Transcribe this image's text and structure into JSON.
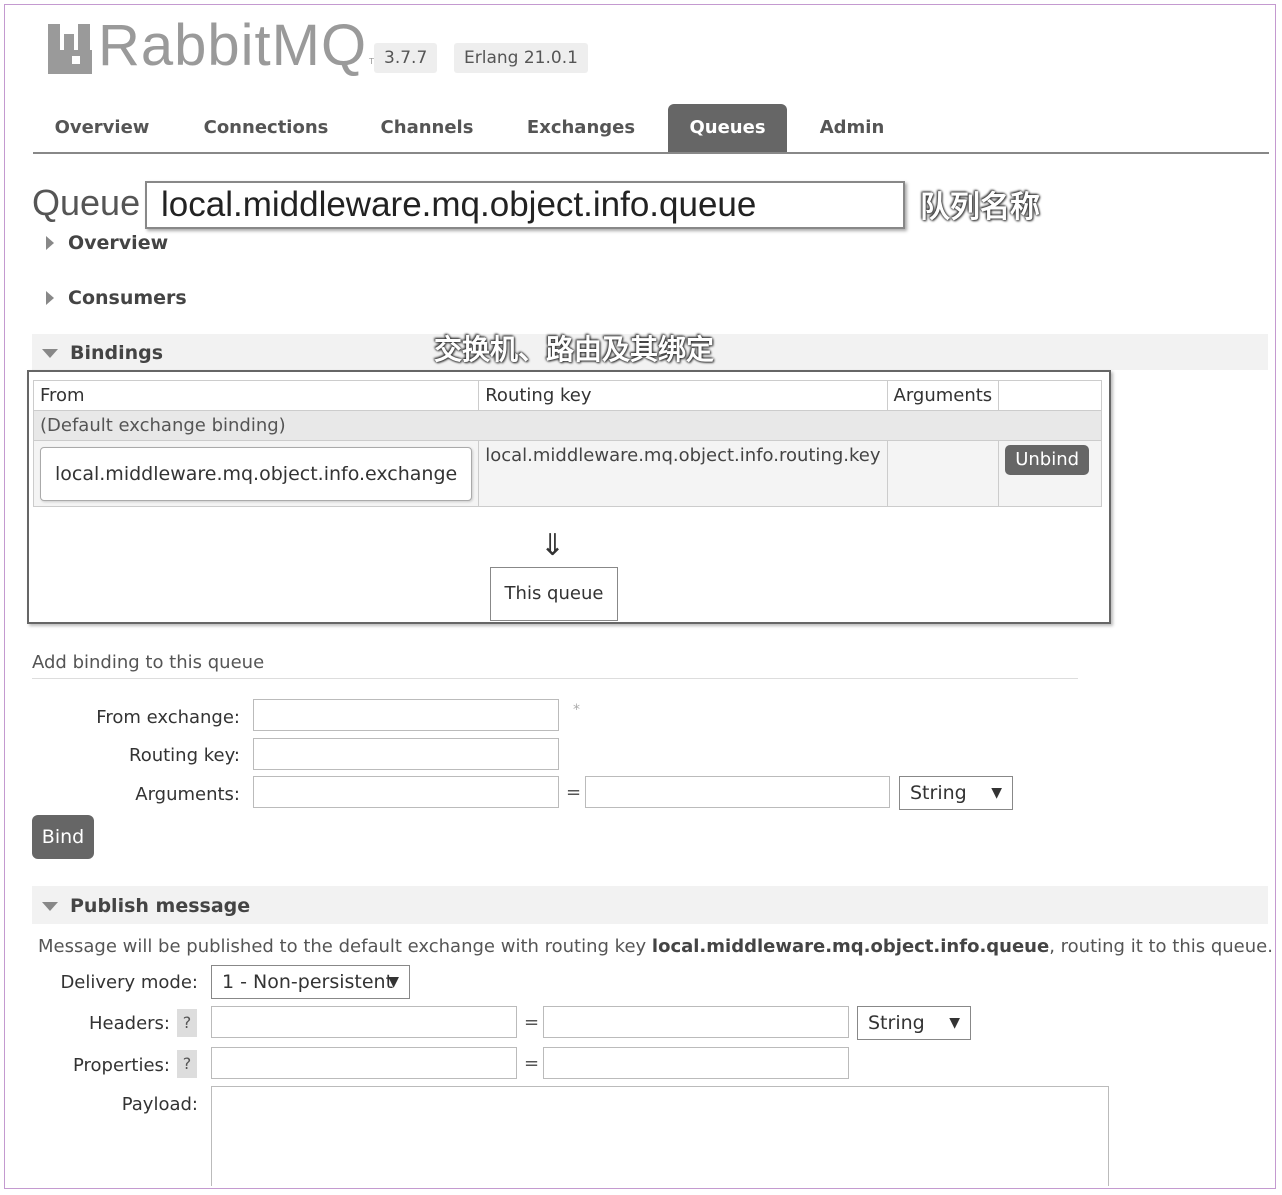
{
  "header": {
    "app_name": "RabbitMQ",
    "tm": "TM",
    "version": "3.7.7",
    "erlang": "Erlang 21.0.1"
  },
  "nav": {
    "tabs": [
      {
        "label": "Overview",
        "active": false
      },
      {
        "label": "Connections",
        "active": false
      },
      {
        "label": "Channels",
        "active": false
      },
      {
        "label": "Exchanges",
        "active": false
      },
      {
        "label": "Queues",
        "active": true
      },
      {
        "label": "Admin",
        "active": false
      }
    ]
  },
  "queue": {
    "label": "Queue",
    "name": "local.middleware.mq.object.info.queue",
    "annotation": "队列名称"
  },
  "sections": {
    "overview": "Overview",
    "consumers": "Consumers",
    "bindings": "Bindings",
    "bindings_annotation": "交换机、路由及其绑定",
    "publish": "Publish message"
  },
  "bindings_table": {
    "headers": [
      "From",
      "Routing key",
      "Arguments",
      ""
    ],
    "default_row": "(Default exchange binding)",
    "row": {
      "from": "local.middleware.mq.object.info.exchange",
      "routing_key": "local.middleware.mq.object.info.routing.key",
      "arguments": "",
      "action": "Unbind"
    },
    "arrow": "⇓",
    "this_queue": "This queue"
  },
  "add_binding": {
    "heading": "Add binding to this queue",
    "from_exchange_label": "From exchange:",
    "required_mark": "*",
    "routing_key_label": "Routing key:",
    "arguments_label": "Arguments:",
    "equals": "=",
    "type_value": "String",
    "bind_button": "Bind"
  },
  "publish": {
    "note_prefix": "Message will be published to the default exchange with routing key ",
    "note_key": "local.middleware.mq.object.info.queue",
    "note_suffix": ", routing it to this queue.",
    "delivery_mode_label": "Delivery mode:",
    "delivery_mode_value": "1 - Non-persistent",
    "headers_label": "Headers:",
    "properties_label": "Properties:",
    "help": "?",
    "equals": "=",
    "type_value": "String",
    "payload_label": "Payload:"
  },
  "icons": {
    "dropdown": "▼"
  }
}
